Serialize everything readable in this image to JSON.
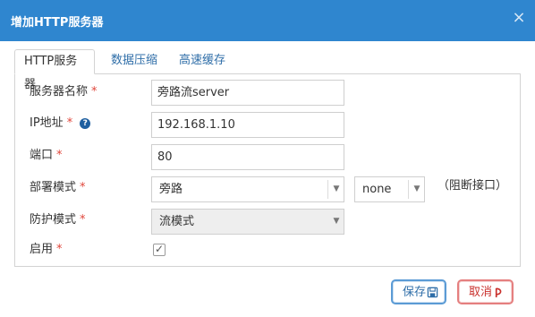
{
  "dialog": {
    "title": "增加HTTP服务器",
    "close_label": "×"
  },
  "tabs": [
    {
      "label": "HTTP服务器",
      "active": true
    },
    {
      "label": "数据压缩",
      "active": false
    },
    {
      "label": "高速缓存",
      "active": false
    }
  ],
  "form": {
    "server_name": {
      "label": "服务器名称",
      "required": "*",
      "value": "旁路流server"
    },
    "ip": {
      "label": "IP地址",
      "required": "*",
      "help_icon": "question-circle-icon",
      "help_glyph": "?",
      "value": "192.168.1.10"
    },
    "port": {
      "label": "端口",
      "required": "*",
      "value": "80"
    },
    "deploy_mode": {
      "label": "部署模式",
      "required": "*",
      "value": "旁路",
      "secondary_value": "none",
      "note": "（阻断接口）"
    },
    "protect_mode": {
      "label": "防护模式",
      "required": "*",
      "value": "流模式",
      "disabled": true
    },
    "enable": {
      "label": "启用",
      "required": "*",
      "checked": true
    }
  },
  "buttons": {
    "save": {
      "label": "保存",
      "icon": "save-icon"
    },
    "cancel": {
      "label": "取消",
      "icon": "undo-icon"
    }
  },
  "colors": {
    "title_bar": "#2f86cf",
    "required": "#e0463b",
    "save_border": "#5b9bd5",
    "cancel_border": "#e57f7f"
  }
}
